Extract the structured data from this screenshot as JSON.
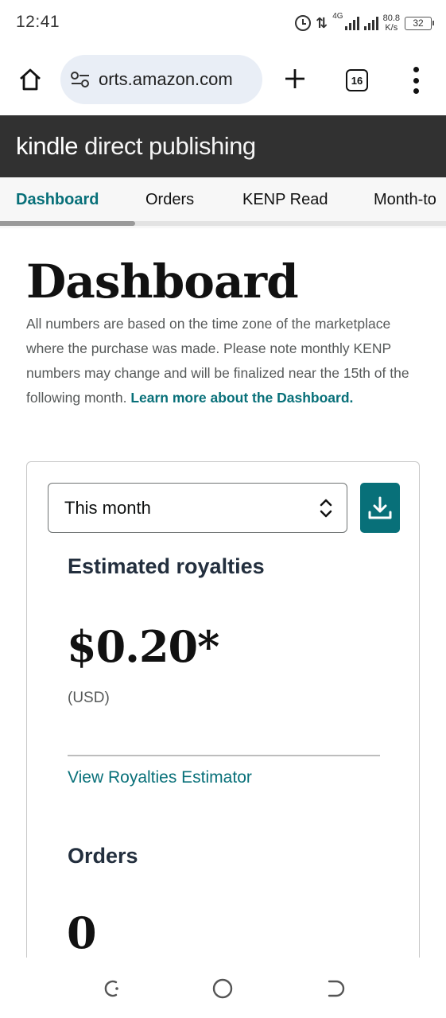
{
  "status_bar": {
    "time": "12:41",
    "network_type": "4G",
    "speed_value": "80.8",
    "speed_unit": "K/s",
    "battery": "32"
  },
  "browser": {
    "url": "orts.amazon.com",
    "tab_count": "16",
    "icons": [
      "home-icon",
      "site-settings-icon",
      "new-tab-icon",
      "tabs-icon",
      "menu-icon"
    ]
  },
  "header": {
    "logo_kindle": "kindle",
    "logo_rest": "direct publishing"
  },
  "nav": {
    "tabs": [
      {
        "label": "Dashboard",
        "active": true
      },
      {
        "label": "Orders",
        "active": false
      },
      {
        "label": "KENP Read",
        "active": false
      },
      {
        "label": "Month-to",
        "active": false
      }
    ]
  },
  "page": {
    "title": "Dashboard",
    "intro": "All numbers are based on the time zone of the marketplace where the purchase was made. Please note monthly KENP numbers may change and will be finalized near the 15th of the following month.",
    "learn_more": "Learn more about the Dashboard."
  },
  "card": {
    "period_value": "This month",
    "royalties": {
      "title": "Estimated royalties",
      "amount": "$0.20*",
      "currency": "(USD)",
      "estimator_link": "View Royalties Estimator"
    },
    "orders": {
      "title": "Orders",
      "value": "0"
    }
  },
  "colors": {
    "accent": "#087079",
    "header_bg": "#313131",
    "text_dark": "#232f3e",
    "text_muted": "#565959"
  }
}
